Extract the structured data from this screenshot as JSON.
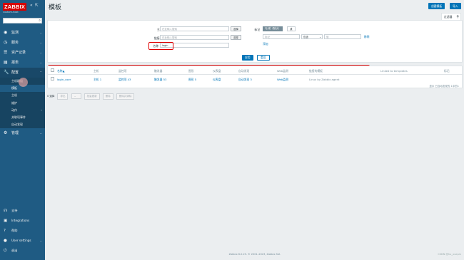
{
  "sidebar": {
    "logo": "ZABBIX",
    "server_name": "custom-host",
    "menu": [
      {
        "label": "监测",
        "icon": "eye-icon"
      },
      {
        "label": "服务",
        "icon": "clock-icon"
      },
      {
        "label": "资产记录",
        "icon": "list-icon"
      },
      {
        "label": "报表",
        "icon": "chart-icon"
      },
      {
        "label": "配置",
        "icon": "wrench-icon"
      }
    ],
    "submenu": [
      "主机群组",
      "模板",
      "主机",
      "维护",
      "动作",
      "关联项事件",
      "自动发现"
    ],
    "admin": "管理",
    "bottom": [
      "支持",
      "Integrations",
      "帮助",
      "User settings",
      "退出"
    ]
  },
  "header": {
    "title": "模板",
    "create_button": "创建模板",
    "import_button": "导入"
  },
  "filter": {
    "tab_label": "过滤器",
    "host_group_label": "主机群组",
    "host_group_placeholder": "在此输入搜索",
    "select_label": "选择",
    "linked_template_label": "链接的模板",
    "linked_template_placeholder": "在此输入搜索",
    "name_label": "名称",
    "name_value": "login",
    "tags_label": "标记",
    "tags_andor": "与/或（默认）",
    "tags_or": "或",
    "tag_placeholder": "标记",
    "tag_operator": "包含",
    "tag_value_placeholder": "值",
    "remove_label": "移除",
    "add_label": "添加",
    "apply_label": "应用",
    "reset_label": "重设"
  },
  "table": {
    "headers": [
      "名称▲",
      "主机",
      "监控项",
      "触发器",
      "图形",
      "仪表盘",
      "自动发现",
      "Web监测",
      "链接的模板",
      "Linked to templates",
      "标记"
    ],
    "rows": [
      {
        "name": "login_user",
        "hosts": "主机 1",
        "items": "监控项 43",
        "triggers": "触发器 53",
        "graphs": "图形 5",
        "dashboards": "仪表盘",
        "discovery": "自动发现 3",
        "web": "Web监测",
        "linked": "Linux by Zabbix agent",
        "linked_to": "",
        "tags": ""
      }
    ],
    "count_text": "显示 已自动发现的 1中的1"
  },
  "actions": {
    "selected": "0 选择",
    "export": "导出",
    "import": "",
    "mass_update": "批量更新",
    "delete": "删除",
    "delete_clear": "删除并清除"
  },
  "footer": "Zabbix 6.0.25. © 2001–2023, Zabbix SIA",
  "watermark": "CSDN @hu_xuepin"
}
